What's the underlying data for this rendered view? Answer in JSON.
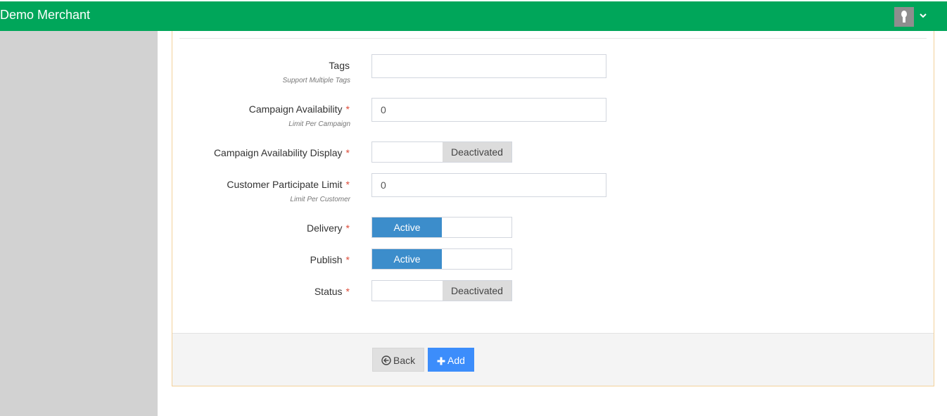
{
  "header": {
    "brand": "Demo Merchant"
  },
  "form": {
    "tags": {
      "label": "Tags",
      "hint": "Support Multiple Tags",
      "value": ""
    },
    "campaign_availability": {
      "label": "Campaign Availability",
      "hint": "Limit Per Campaign",
      "value": "0",
      "required": "*"
    },
    "campaign_availability_display": {
      "label": "Campaign Availability Display",
      "state": "Deactivated",
      "required": "*"
    },
    "customer_participate_limit": {
      "label": "Customer Participate Limit",
      "hint": "Limit Per Customer",
      "value": "0",
      "required": "*"
    },
    "delivery": {
      "label": "Delivery",
      "state": "Active",
      "required": "*"
    },
    "publish": {
      "label": "Publish",
      "state": "Active",
      "required": "*"
    },
    "status": {
      "label": "Status",
      "state": "Deactivated",
      "required": "*"
    }
  },
  "footer": {
    "back_label": "Back",
    "add_label": "Add"
  },
  "icons": {
    "back": "circle-arrow-left-icon",
    "add": "plus-icon",
    "user": "user-avatar-icon",
    "caret": "chevron-down-icon"
  },
  "colors": {
    "topbar": "#00a65a",
    "active_toggle": "#3c8dcb",
    "add_button": "#3c8dfb",
    "required": "#dd4b39"
  }
}
